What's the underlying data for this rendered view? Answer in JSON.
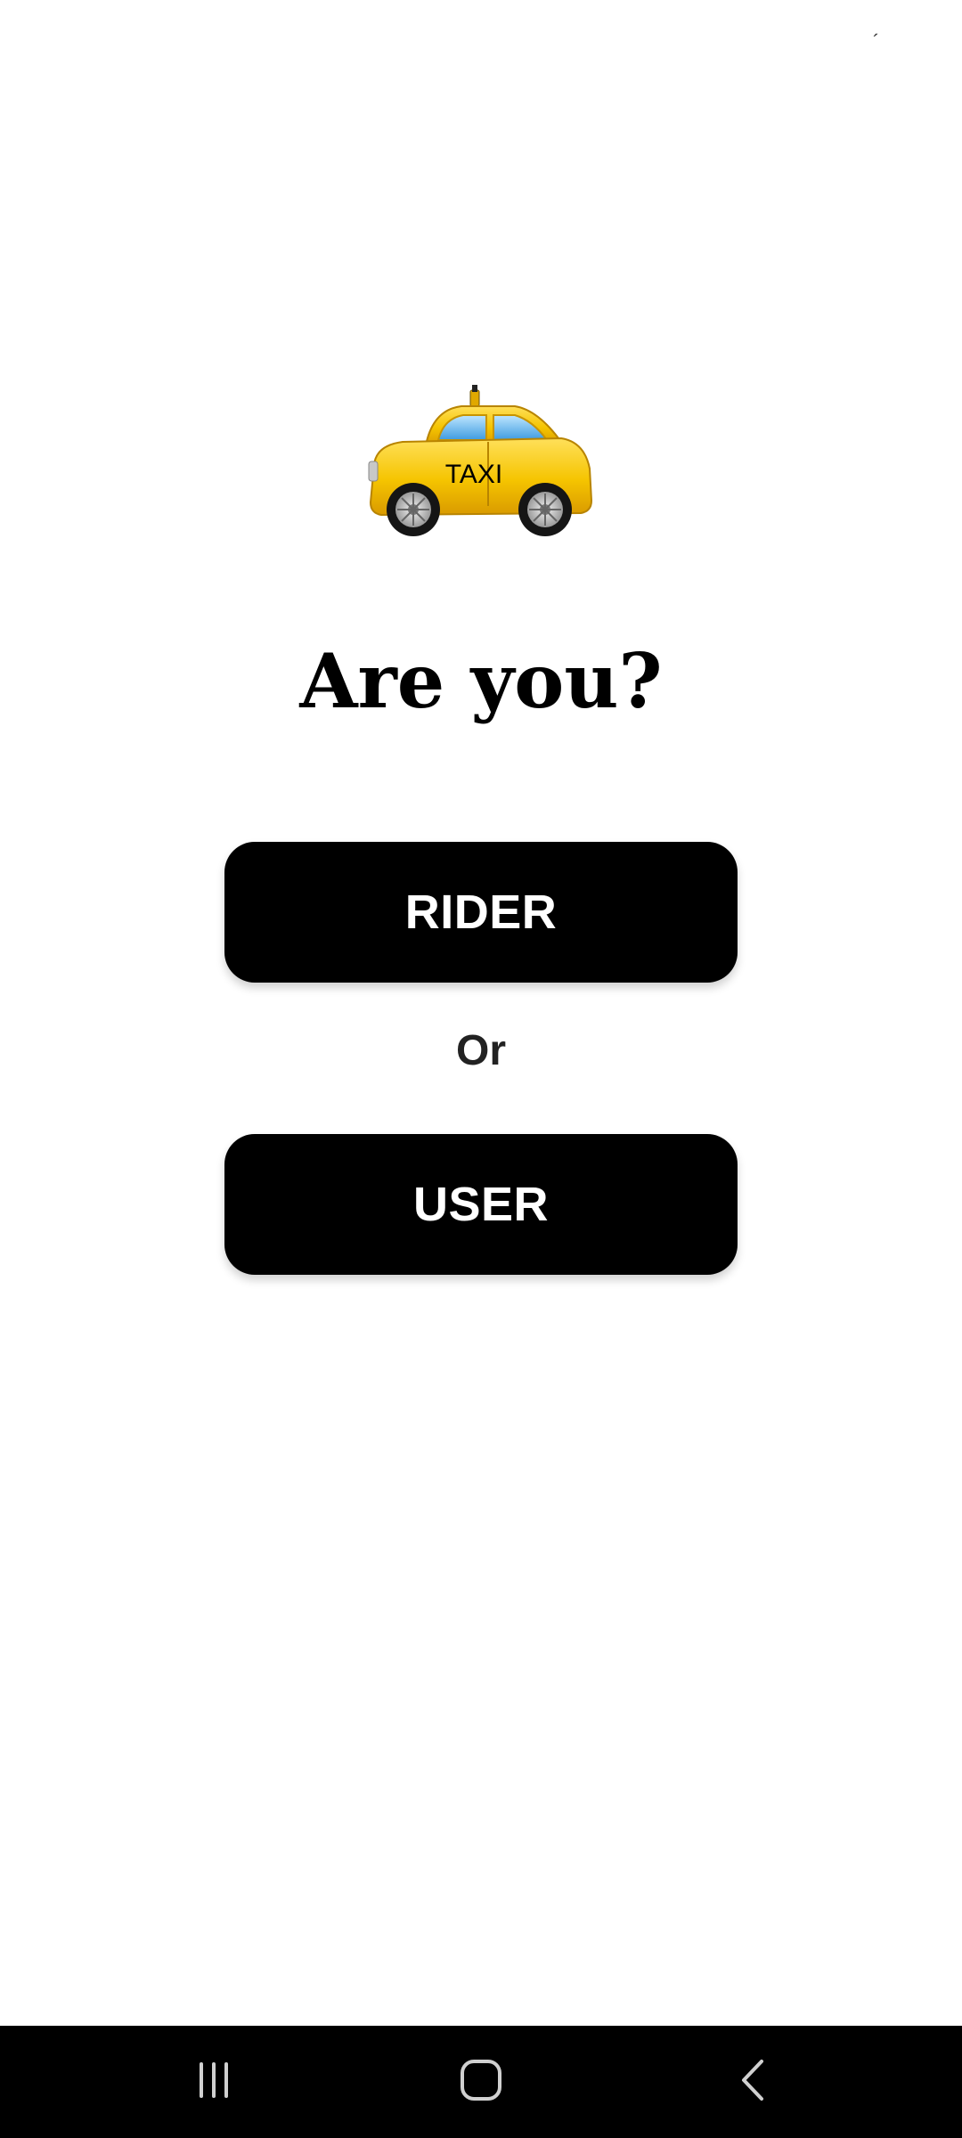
{
  "status_bar": {
    "mark": "´"
  },
  "hero": {
    "icon": "taxi-icon",
    "taxi_label": "TAXI"
  },
  "prompt": {
    "title": "Are you?"
  },
  "choices": {
    "rider_label": "RIDER",
    "separator": "Or",
    "user_label": "USER"
  },
  "nav_bar": {
    "recents_icon": "recents-icon",
    "home_icon": "home-icon",
    "back_icon": "back-icon"
  },
  "colors": {
    "button_bg": "#000000",
    "button_text": "#ffffff",
    "taxi_yellow": "#F5C400",
    "nav_bg": "#000000"
  }
}
